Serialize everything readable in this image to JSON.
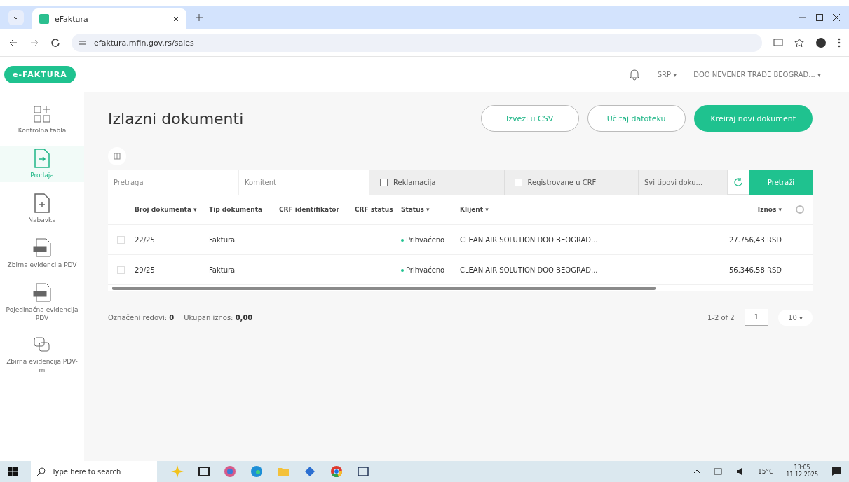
{
  "browser": {
    "tab_title": "eFaktura",
    "url": "efaktura.mfin.gov.rs/sales"
  },
  "header": {
    "logo": "e-FAKTURA",
    "language": "SRP ▾",
    "company": "DOO NEVENER TRADE BEOGRAD... ▾"
  },
  "sidebar": {
    "items": [
      {
        "label": "Kontrolna tabla",
        "kind": "dashboard",
        "selected": false
      },
      {
        "label": "Prodaja",
        "kind": "out",
        "selected": true
      },
      {
        "label": "Nabavka",
        "kind": "in",
        "selected": false
      },
      {
        "label": "Zbirna evidencija PDV",
        "kind": "pdv",
        "selected": false
      },
      {
        "label": "Pojedinačna evidencija PDV",
        "kind": "pdv",
        "selected": false
      },
      {
        "label": "Zbirna evidencija PDV-m",
        "kind": "chat",
        "selected": false
      }
    ]
  },
  "page": {
    "title": "Izlazni dokumenti",
    "buttons": [
      {
        "label": "Izvezi u CSV",
        "kind": "outline"
      },
      {
        "label": "Učitaj datoteku",
        "kind": "outline"
      },
      {
        "label": "Kreiraj novi dokument",
        "kind": "primary"
      }
    ]
  },
  "filters": {
    "search": {
      "placeholder": "Pretraga"
    },
    "client": {
      "placeholder": "Komitent"
    },
    "checkboxes": [
      {
        "label": "Reklamacija",
        "checked": false
      },
      {
        "label": "Registrovane u CRF",
        "checked": false
      }
    ],
    "type_select": "Svi tipovi doku...",
    "search_button": "Pretraži"
  },
  "table": {
    "columns": [
      "Broj dokumenta ▾",
      "Tip dokumenta",
      "CRF identifikator",
      "CRF status",
      "Status ▾",
      "Klijent ▾",
      "Iznos ▾"
    ],
    "rows": [
      {
        "number": "22/25",
        "type": "Faktura",
        "status": "Prihvaćeno",
        "client": "CLEAN AIR SOLUTION DOO BEOGRAD...",
        "amount": "27.756,43 RSD",
        "checked": false
      },
      {
        "number": "29/25",
        "type": "Faktura",
        "status": "Prihvaćeno",
        "client": "CLEAN AIR SOLUTION DOO BEOGRAD...",
        "amount": "56.346,58 RSD",
        "checked": false
      }
    ]
  },
  "footer": {
    "selected_label": "Označeni redovi:",
    "selected_value": "0",
    "total_label": "Ukupan iznos:",
    "total_value": "0,00",
    "range": "1-2 of 2",
    "page": "1",
    "per_page": "10 ▾"
  },
  "taskbar": {
    "search_placeholder": "Type here to search",
    "time": "13:05",
    "date": "11.12.2025",
    "temp": "15°C"
  }
}
